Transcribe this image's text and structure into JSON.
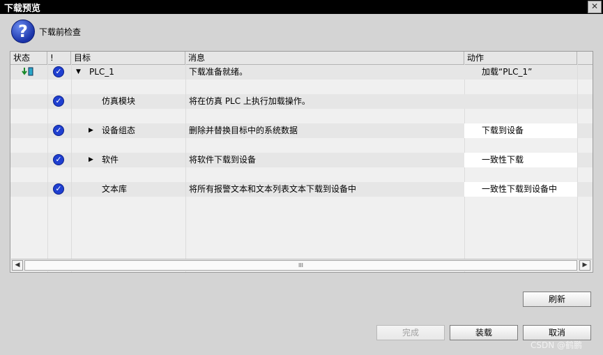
{
  "window": {
    "title": "下载预览",
    "close_label": "✕"
  },
  "hint": {
    "text": "下载前检查",
    "icon": "question-icon"
  },
  "table": {
    "columns": [
      "状态",
      "!",
      "目标",
      "消息",
      "动作"
    ],
    "rows": [
      {
        "target": "PLC_1",
        "message": "下载准备就绪。",
        "action": "加载“PLC_1”",
        "expander": "▼",
        "status_icon": "download-status-icon"
      },
      {
        "target": "仿真模块",
        "message": "将在仿真 PLC 上执行加载操作。",
        "action": ""
      },
      {
        "target": "设备组态",
        "message": "删除并替换目标中的系统数据",
        "action": "下载到设备",
        "expander": "▶"
      },
      {
        "target": "软件",
        "message": "将软件下载到设备",
        "action": "一致性下载",
        "expander": "▶"
      },
      {
        "target": "文本库",
        "message": "将所有报警文本和文本列表文本下载到设备中",
        "action": "一致性下载到设备中"
      }
    ]
  },
  "scrollbar": {
    "left": "◀",
    "right": "▶",
    "thumb": "III"
  },
  "buttons": {
    "refresh": "刷新",
    "finish": "完成",
    "load": "装载",
    "cancel": "取消"
  },
  "watermark": "CSDN @鹤鹏"
}
